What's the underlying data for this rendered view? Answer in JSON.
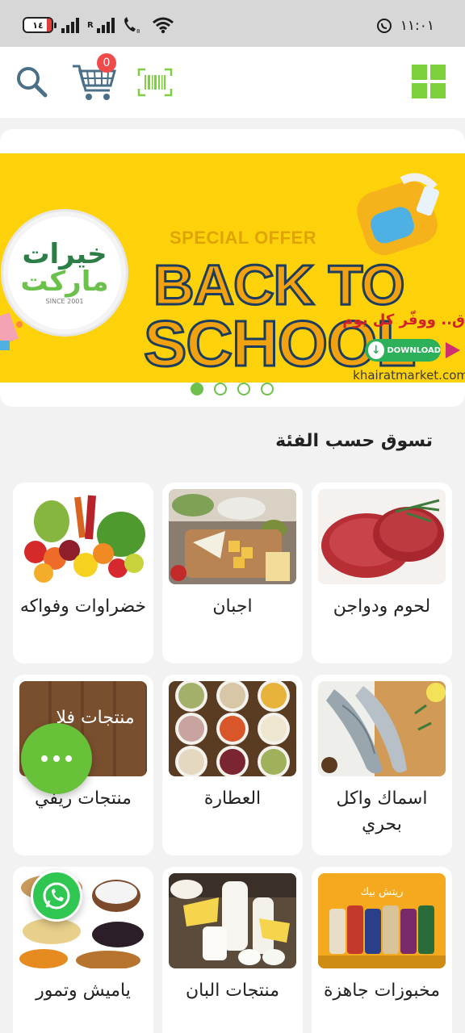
{
  "status_bar": {
    "battery": "١٤",
    "sim_label": "R",
    "time": "١١:٠١"
  },
  "header": {
    "icons": [
      "search-icon",
      "cart-icon",
      "barcode-scan-icon",
      "grid-menu-icon"
    ],
    "cart_count": "0",
    "accent_color": "#7dd13d"
  },
  "banner": {
    "logo_line1": "خيرات",
    "logo_line2": "ماركت",
    "logo_since": "SINCE 2001",
    "special_offer": "SPECIAL OFFER",
    "headline_line1": "BACK TO",
    "headline_line2": "SCHOOL",
    "tagline": "ق.. ووفّر كل يوم",
    "download_label": "DOWNLOAD",
    "url": "khairatmarket.com",
    "slide_count": 4,
    "active_slide": 1
  },
  "section": {
    "title": "تسوق حسب الفئة"
  },
  "categories": [
    {
      "name": "لحوم ودواجن"
    },
    {
      "name": "اجبان"
    },
    {
      "name": "خضراوات وفواكه"
    },
    {
      "name": "اسماك واكل بحري"
    },
    {
      "name": "العطارة"
    },
    {
      "name": "منتجات ريفي",
      "image_caption": "منتجات فلا"
    },
    {
      "name": "مخبوزات جاهزة",
      "image_caption": "ريتش بيك"
    },
    {
      "name": "منتجات البان"
    },
    {
      "name": "ياميش وتمور"
    }
  ]
}
